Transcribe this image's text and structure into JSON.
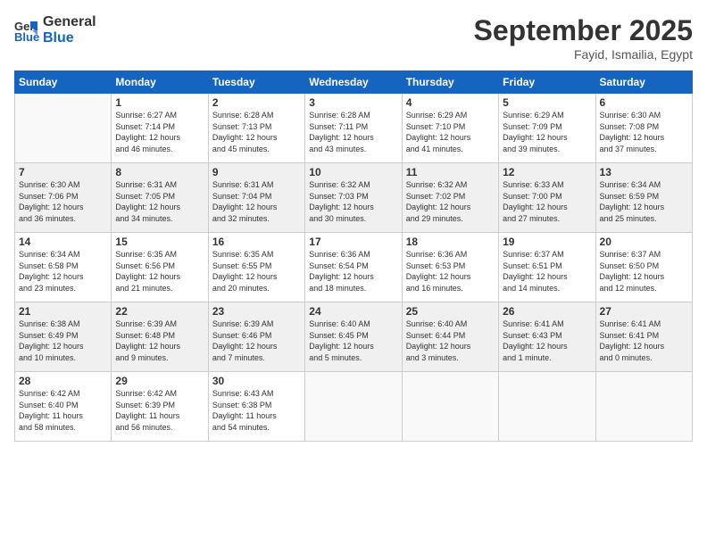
{
  "logo": {
    "line1": "General",
    "line2": "Blue"
  },
  "header": {
    "month": "September 2025",
    "location": "Fayid, Ismailia, Egypt"
  },
  "weekdays": [
    "Sunday",
    "Monday",
    "Tuesday",
    "Wednesday",
    "Thursday",
    "Friday",
    "Saturday"
  ],
  "weeks": [
    [
      {
        "day": "",
        "info": ""
      },
      {
        "day": "1",
        "info": "Sunrise: 6:27 AM\nSunset: 7:14 PM\nDaylight: 12 hours\nand 46 minutes."
      },
      {
        "day": "2",
        "info": "Sunrise: 6:28 AM\nSunset: 7:13 PM\nDaylight: 12 hours\nand 45 minutes."
      },
      {
        "day": "3",
        "info": "Sunrise: 6:28 AM\nSunset: 7:11 PM\nDaylight: 12 hours\nand 43 minutes."
      },
      {
        "day": "4",
        "info": "Sunrise: 6:29 AM\nSunset: 7:10 PM\nDaylight: 12 hours\nand 41 minutes."
      },
      {
        "day": "5",
        "info": "Sunrise: 6:29 AM\nSunset: 7:09 PM\nDaylight: 12 hours\nand 39 minutes."
      },
      {
        "day": "6",
        "info": "Sunrise: 6:30 AM\nSunset: 7:08 PM\nDaylight: 12 hours\nand 37 minutes."
      }
    ],
    [
      {
        "day": "7",
        "info": "Sunrise: 6:30 AM\nSunset: 7:06 PM\nDaylight: 12 hours\nand 36 minutes."
      },
      {
        "day": "8",
        "info": "Sunrise: 6:31 AM\nSunset: 7:05 PM\nDaylight: 12 hours\nand 34 minutes."
      },
      {
        "day": "9",
        "info": "Sunrise: 6:31 AM\nSunset: 7:04 PM\nDaylight: 12 hours\nand 32 minutes."
      },
      {
        "day": "10",
        "info": "Sunrise: 6:32 AM\nSunset: 7:03 PM\nDaylight: 12 hours\nand 30 minutes."
      },
      {
        "day": "11",
        "info": "Sunrise: 6:32 AM\nSunset: 7:02 PM\nDaylight: 12 hours\nand 29 minutes."
      },
      {
        "day": "12",
        "info": "Sunrise: 6:33 AM\nSunset: 7:00 PM\nDaylight: 12 hours\nand 27 minutes."
      },
      {
        "day": "13",
        "info": "Sunrise: 6:34 AM\nSunset: 6:59 PM\nDaylight: 12 hours\nand 25 minutes."
      }
    ],
    [
      {
        "day": "14",
        "info": "Sunrise: 6:34 AM\nSunset: 6:58 PM\nDaylight: 12 hours\nand 23 minutes."
      },
      {
        "day": "15",
        "info": "Sunrise: 6:35 AM\nSunset: 6:56 PM\nDaylight: 12 hours\nand 21 minutes."
      },
      {
        "day": "16",
        "info": "Sunrise: 6:35 AM\nSunset: 6:55 PM\nDaylight: 12 hours\nand 20 minutes."
      },
      {
        "day": "17",
        "info": "Sunrise: 6:36 AM\nSunset: 6:54 PM\nDaylight: 12 hours\nand 18 minutes."
      },
      {
        "day": "18",
        "info": "Sunrise: 6:36 AM\nSunset: 6:53 PM\nDaylight: 12 hours\nand 16 minutes."
      },
      {
        "day": "19",
        "info": "Sunrise: 6:37 AM\nSunset: 6:51 PM\nDaylight: 12 hours\nand 14 minutes."
      },
      {
        "day": "20",
        "info": "Sunrise: 6:37 AM\nSunset: 6:50 PM\nDaylight: 12 hours\nand 12 minutes."
      }
    ],
    [
      {
        "day": "21",
        "info": "Sunrise: 6:38 AM\nSunset: 6:49 PM\nDaylight: 12 hours\nand 10 minutes."
      },
      {
        "day": "22",
        "info": "Sunrise: 6:39 AM\nSunset: 6:48 PM\nDaylight: 12 hours\nand 9 minutes."
      },
      {
        "day": "23",
        "info": "Sunrise: 6:39 AM\nSunset: 6:46 PM\nDaylight: 12 hours\nand 7 minutes."
      },
      {
        "day": "24",
        "info": "Sunrise: 6:40 AM\nSunset: 6:45 PM\nDaylight: 12 hours\nand 5 minutes."
      },
      {
        "day": "25",
        "info": "Sunrise: 6:40 AM\nSunset: 6:44 PM\nDaylight: 12 hours\nand 3 minutes."
      },
      {
        "day": "26",
        "info": "Sunrise: 6:41 AM\nSunset: 6:43 PM\nDaylight: 12 hours\nand 1 minute."
      },
      {
        "day": "27",
        "info": "Sunrise: 6:41 AM\nSunset: 6:41 PM\nDaylight: 12 hours\nand 0 minutes."
      }
    ],
    [
      {
        "day": "28",
        "info": "Sunrise: 6:42 AM\nSunset: 6:40 PM\nDaylight: 11 hours\nand 58 minutes."
      },
      {
        "day": "29",
        "info": "Sunrise: 6:42 AM\nSunset: 6:39 PM\nDaylight: 11 hours\nand 56 minutes."
      },
      {
        "day": "30",
        "info": "Sunrise: 6:43 AM\nSunset: 6:38 PM\nDaylight: 11 hours\nand 54 minutes."
      },
      {
        "day": "",
        "info": ""
      },
      {
        "day": "",
        "info": ""
      },
      {
        "day": "",
        "info": ""
      },
      {
        "day": "",
        "info": ""
      }
    ]
  ]
}
